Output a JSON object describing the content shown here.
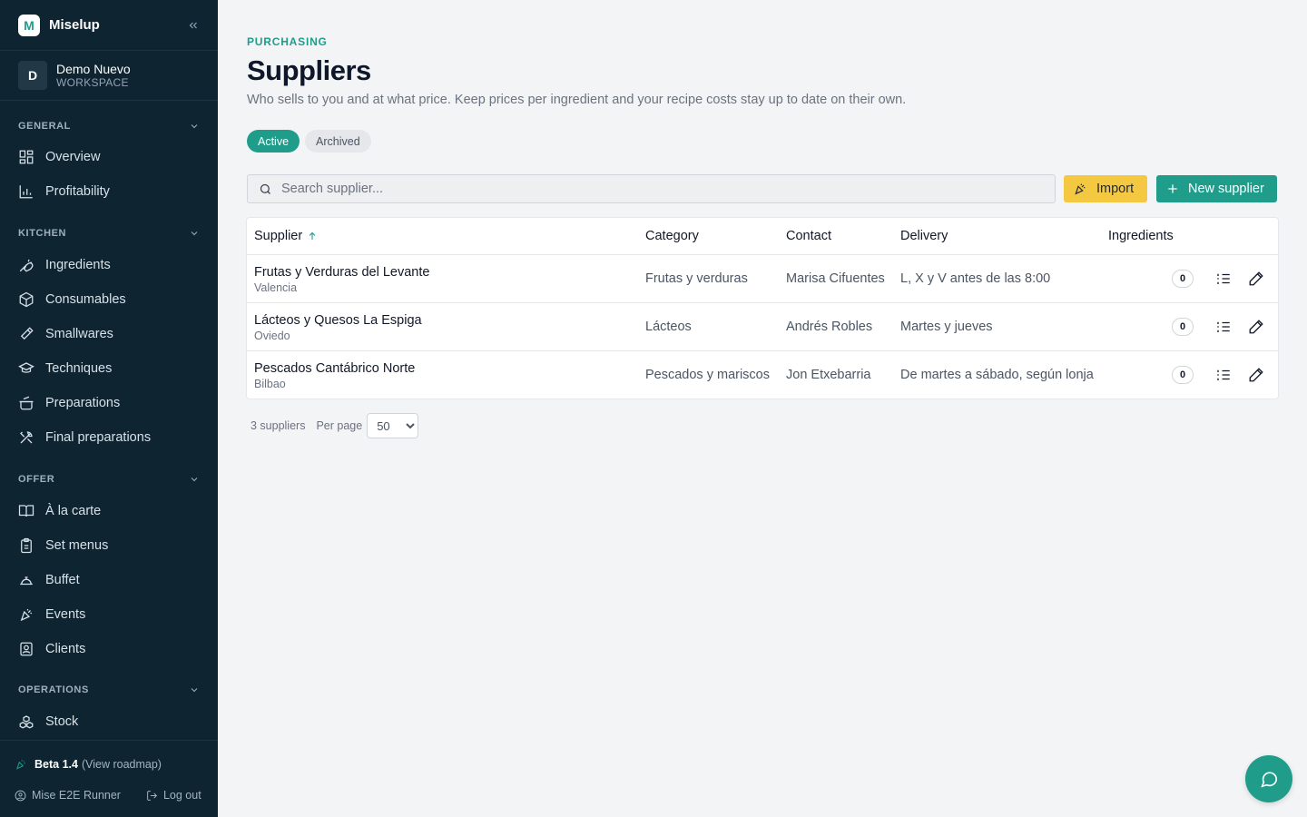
{
  "app": {
    "name": "Miselup",
    "logo_letter": "M"
  },
  "workspace": {
    "initial": "D",
    "name": "Demo Nuevo",
    "label": "WORKSPACE"
  },
  "sidebar": {
    "sections": [
      {
        "title": "GENERAL",
        "items": [
          {
            "label": "Overview",
            "icon": "overview-icon"
          },
          {
            "label": "Profitability",
            "icon": "chart-icon"
          }
        ]
      },
      {
        "title": "KITCHEN",
        "items": [
          {
            "label": "Ingredients",
            "icon": "carrot-icon"
          },
          {
            "label": "Consumables",
            "icon": "box-icon"
          },
          {
            "label": "Smallwares",
            "icon": "hammer-icon"
          },
          {
            "label": "Techniques",
            "icon": "graduation-cap-icon"
          },
          {
            "label": "Preparations",
            "icon": "cooking-pot-icon"
          },
          {
            "label": "Final preparations",
            "icon": "utensils-icon"
          }
        ]
      },
      {
        "title": "OFFER",
        "items": [
          {
            "label": "À la carte",
            "icon": "book-icon"
          },
          {
            "label": "Set menus",
            "icon": "clipboard-icon"
          },
          {
            "label": "Buffet",
            "icon": "cloche-icon"
          },
          {
            "label": "Events",
            "icon": "party-icon"
          },
          {
            "label": "Clients",
            "icon": "contact-icon"
          }
        ]
      },
      {
        "title": "OPERATIONS",
        "items": [
          {
            "label": "Stock",
            "icon": "boxes-icon"
          }
        ]
      }
    ]
  },
  "footer": {
    "beta": "Beta 1.4",
    "roadmap": "(View roadmap)",
    "user": "Mise E2E Runner",
    "logout": "Log out"
  },
  "page": {
    "eyebrow": "PURCHASING",
    "title": "Suppliers",
    "subtitle": "Who sells to you and at what price. Keep prices per ingredient and your recipe costs stay up to date on their own."
  },
  "filters": {
    "active": "Active",
    "archived": "Archived"
  },
  "search": {
    "placeholder": "Search supplier..."
  },
  "actions": {
    "import": "Import",
    "new_supplier": "New supplier"
  },
  "table": {
    "columns": {
      "supplier": "Supplier",
      "category": "Category",
      "contact": "Contact",
      "delivery": "Delivery",
      "ingredients": "Ingredients"
    },
    "sort": {
      "column": "supplier",
      "direction": "asc"
    },
    "rows": [
      {
        "name": "Frutas y Verduras del Levante",
        "city": "Valencia",
        "category": "Frutas y verduras",
        "contact": "Marisa Cifuentes",
        "delivery": "L, X y V antes de las 8:00",
        "ingredients": "0"
      },
      {
        "name": "Lácteos y Quesos La Espiga",
        "city": "Oviedo",
        "category": "Lácteos",
        "contact": "Andrés Robles",
        "delivery": "Martes y jueves",
        "ingredients": "0"
      },
      {
        "name": "Pescados Cantábrico Norte",
        "city": "Bilbao",
        "category": "Pescados y mariscos",
        "contact": "Jon Etxebarria",
        "delivery": "De martes a sábado, según lonja",
        "ingredients": "0"
      }
    ]
  },
  "pager": {
    "count": "3 suppliers",
    "per_page_label": "Per page",
    "per_page_value": "50"
  },
  "colors": {
    "sidebar_bg": "#0f2431",
    "accent": "#1f9d8a",
    "import_bg": "#f5c842",
    "page_bg": "#f3f4f6"
  }
}
